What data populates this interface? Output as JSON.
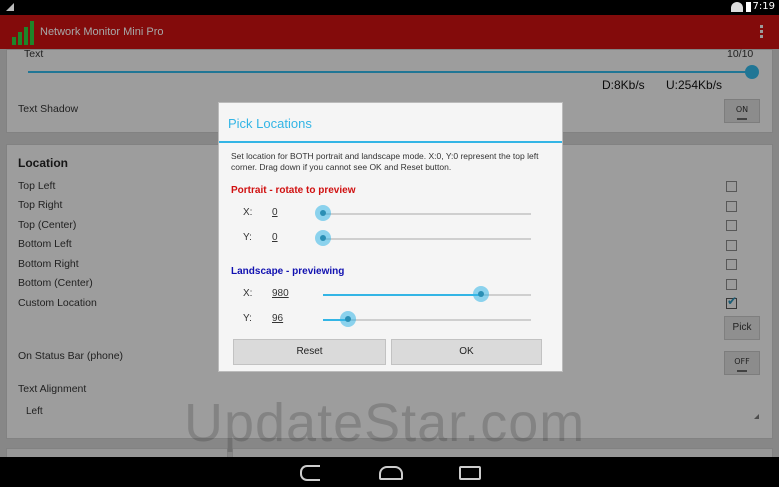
{
  "status_bar": {
    "time": "7:19"
  },
  "app_bar": {
    "title": "Network Monitor Mini Pro"
  },
  "settings": {
    "text_slider": {
      "label": "Text",
      "value_label": "10/10",
      "fraction": 0.99
    },
    "preview": {
      "download": "D:8Kb/s",
      "upload": "U:254Kb/s"
    },
    "text_shadow": {
      "label": "Text Shadow",
      "toggle": "ON"
    },
    "location": {
      "header": "Location",
      "options": [
        {
          "label": "Top Left",
          "checked": false
        },
        {
          "label": "Top Right",
          "checked": false
        },
        {
          "label": "Top (Center)",
          "checked": false
        },
        {
          "label": "Bottom Left",
          "checked": false
        },
        {
          "label": "Bottom Right",
          "checked": false
        },
        {
          "label": "Bottom (Center)",
          "checked": false
        },
        {
          "label": "Custom Location",
          "checked": true
        }
      ],
      "pick_button": "Pick",
      "on_status_bar": {
        "label": "On Status Bar (phone)",
        "toggle": "OFF"
      },
      "text_alignment": {
        "label": "Text Alignment",
        "value": "Left"
      }
    }
  },
  "dialog": {
    "title": "Pick Locations",
    "description": "Set location for BOTH portrait and landscape mode. X:0, Y:0 represent the top left corner. Drag down if you cannot see OK and Reset button.",
    "portrait": {
      "heading": "Portrait - rotate to preview",
      "x": {
        "label": "X:",
        "value": "0",
        "fraction": 0.0
      },
      "y": {
        "label": "Y:",
        "value": "0",
        "fraction": 0.0
      }
    },
    "landscape": {
      "heading": "Landscape - previewing",
      "x": {
        "label": "X:",
        "value": "980",
        "fraction": 0.76
      },
      "y": {
        "label": "Y:",
        "value": "96",
        "fraction": 0.12
      }
    },
    "reset_button": "Reset",
    "ok_button": "OK"
  },
  "watermark": "UpdateStar.com",
  "colors": {
    "accent": "#33b5e5",
    "action_bar": "#c91212",
    "portrait_heading": "#d01010",
    "landscape_heading": "#1010b0"
  }
}
